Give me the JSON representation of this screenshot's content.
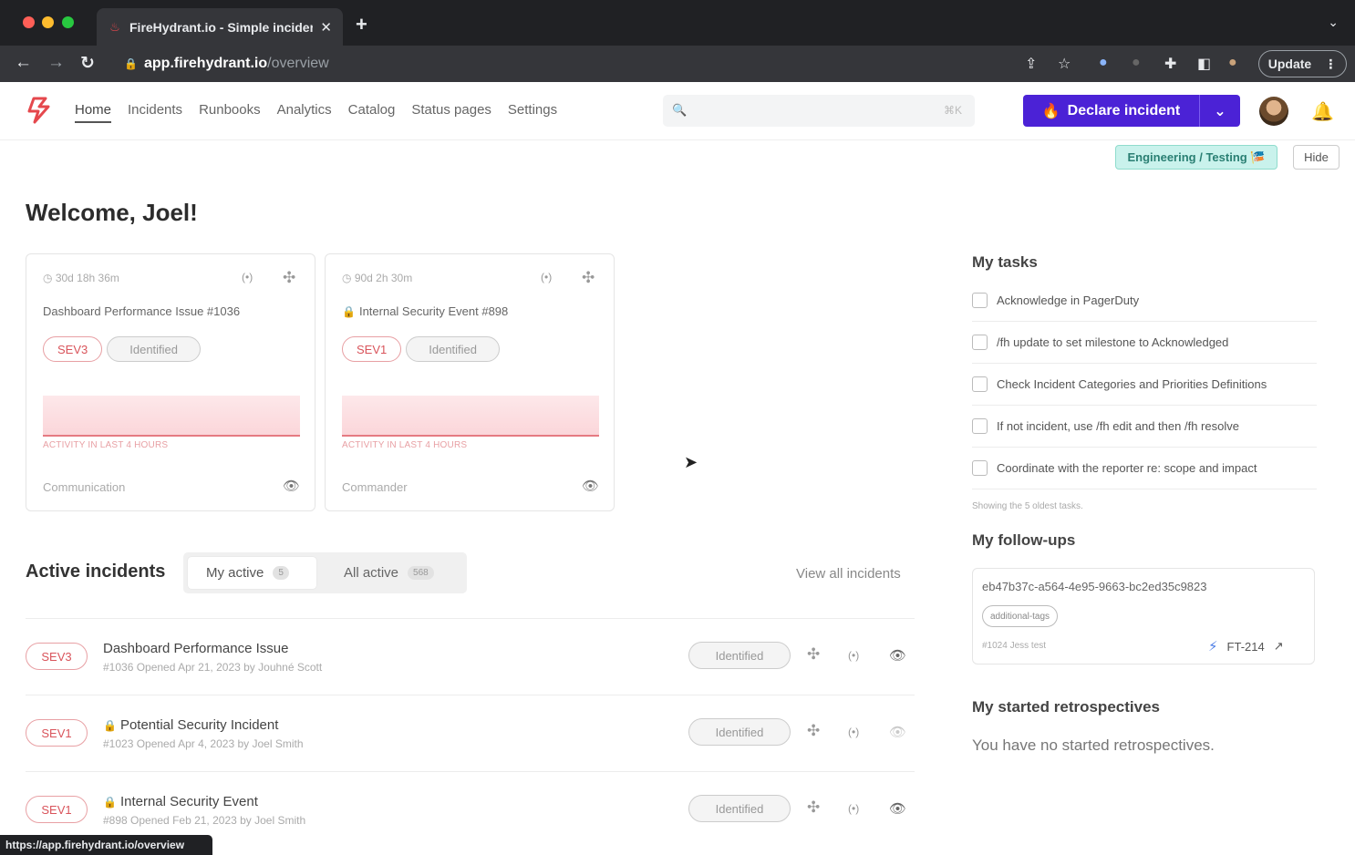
{
  "browser": {
    "tab_title": "FireHydrant.io - Simple incider",
    "tab_close": "✕",
    "new_tab": "+",
    "url_host": "app.firehydrant.io",
    "url_path": "/overview",
    "update_label": "Update",
    "status_url": "https://app.firehydrant.io/overview"
  },
  "nav": {
    "links": [
      "Home",
      "Incidents",
      "Runbooks",
      "Analytics",
      "Catalog",
      "Status pages",
      "Settings"
    ],
    "search_shortcut": "⌘K",
    "declare_label": "Declare incident"
  },
  "env_badge": "Engineering / Testing 🎏",
  "hide_label": "Hide",
  "welcome": "Welcome, Joel!",
  "cards": [
    {
      "timer": "30d 18h 36m",
      "title": "Dashboard Performance Issue #1036",
      "locked": false,
      "severity": "SEV3",
      "status": "Identified",
      "activity_label": "ACTIVITY IN LAST 4 HOURS",
      "role": "Communication"
    },
    {
      "timer": "90d 2h 30m",
      "title": "Internal Security Event #898",
      "locked": true,
      "severity": "SEV1",
      "status": "Identified",
      "activity_label": "ACTIVITY IN LAST 4 HOURS",
      "role": "Commander"
    }
  ],
  "active_incidents": {
    "title": "Active incidents",
    "my_active_label": "My active",
    "my_active_count": "5",
    "all_active_label": "All active",
    "all_active_count": "568",
    "view_all": "View all incidents",
    "rows": [
      {
        "severity": "SEV3",
        "name": "Dashboard Performance Issue",
        "locked": false,
        "meta": "#1036 Opened Apr 21, 2023 by Jouhné Scott",
        "status": "Identified"
      },
      {
        "severity": "SEV1",
        "name": "Potential Security Incident",
        "locked": true,
        "meta": "#1023 Opened Apr 4, 2023 by Joel Smith",
        "status": "Identified"
      },
      {
        "severity": "SEV1",
        "name": "Internal Security Event",
        "locked": true,
        "meta": "#898 Opened Feb 21, 2023 by Joel Smith",
        "status": "Identified"
      }
    ]
  },
  "tasks": {
    "title": "My tasks",
    "items": [
      "Acknowledge in PagerDuty",
      "/fh update to set milestone to Acknowledged",
      "Check Incident Categories and Priorities Definitions",
      "If not incident, use /fh edit and then /fh resolve",
      "Coordinate with the reporter re: scope and impact"
    ],
    "showing": "Showing the 5 oldest tasks."
  },
  "followups": {
    "title": "My follow-ups",
    "uuid": "eb47b37c-a564-4e95-9663-bc2ed35c9823",
    "tag": "additional-tags",
    "ref": "#1024 Jess test",
    "ticket": "FT-214"
  },
  "retros": {
    "title": "My started retrospectives",
    "empty": "You have no started retrospectives."
  },
  "colors": {
    "brand": "#4b22d6",
    "sev": "#d9545b",
    "env": "#c9f2ec"
  }
}
